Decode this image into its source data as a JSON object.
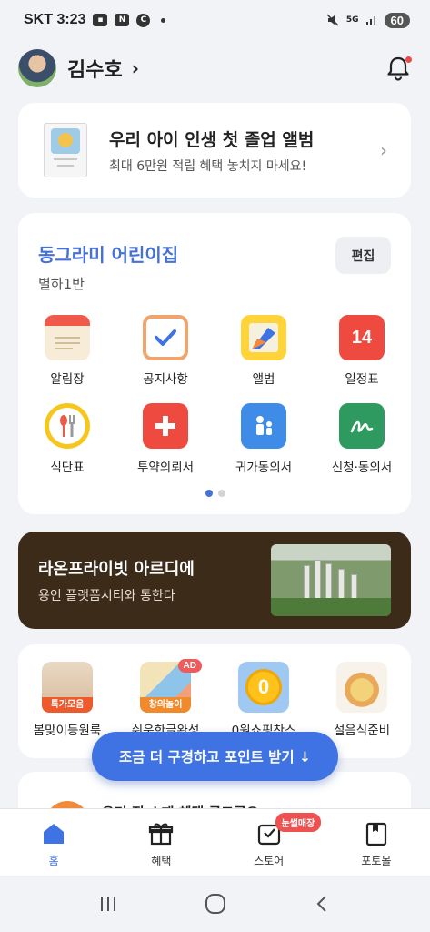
{
  "status_bar": {
    "carrier_time": "SKT 3:23",
    "icon_n": "N",
    "icon_c": "C",
    "network": "5G",
    "battery": "60"
  },
  "header": {
    "user_name": "김수호",
    "chevron": "›"
  },
  "album_promo": {
    "title": "우리 아이 인생 첫 졸업 앨범",
    "subtitle": "최대 6만원 적립 혜택 놓치지 마세요!"
  },
  "kindergarten": {
    "name": "동그라미 어린이집",
    "class_name": "별하1반",
    "edit_label": "편집",
    "menu": [
      {
        "label": "알림장",
        "icon": "notebook-icon"
      },
      {
        "label": "공지사항",
        "icon": "checklist-icon"
      },
      {
        "label": "앨범",
        "icon": "album-icon"
      },
      {
        "label": "일정표",
        "icon": "calendar-icon",
        "number": "14"
      },
      {
        "label": "식단표",
        "icon": "utensils-icon"
      },
      {
        "label": "투약의뢰서",
        "icon": "medicine-icon"
      },
      {
        "label": "귀가동의서",
        "icon": "family-icon"
      },
      {
        "label": "신청·동의서",
        "icon": "signature-icon"
      }
    ],
    "pager_active": 1,
    "pager_total": 2
  },
  "banner": {
    "title": "라온프라이빗 아르디에",
    "subtitle": "용인 플랫폼시티와 통한다"
  },
  "shopping": {
    "items": [
      {
        "label": "봄맞이등원룩",
        "tag": "특가모음"
      },
      {
        "label": "쉬운한글완성",
        "badge": "AD",
        "tag": "창의놀이"
      },
      {
        "label": "0원쇼핑찬스"
      },
      {
        "label": "설음식준비"
      }
    ]
  },
  "floating_button": {
    "label": "조금 더 구경하고 포인트 받기 ↓"
  },
  "partial_card": {
    "text": "우리 집 소재 혜택 골고루요"
  },
  "bottom_nav": {
    "items": [
      {
        "label": "홈",
        "active": true
      },
      {
        "label": "혜택"
      },
      {
        "label": "스토어",
        "badge": "눈썰매장"
      },
      {
        "label": "포토몰"
      }
    ]
  },
  "colors": {
    "accent": "#3f73e3",
    "banner_bg": "#3d2b1a",
    "badge_red": "#ef5050"
  }
}
